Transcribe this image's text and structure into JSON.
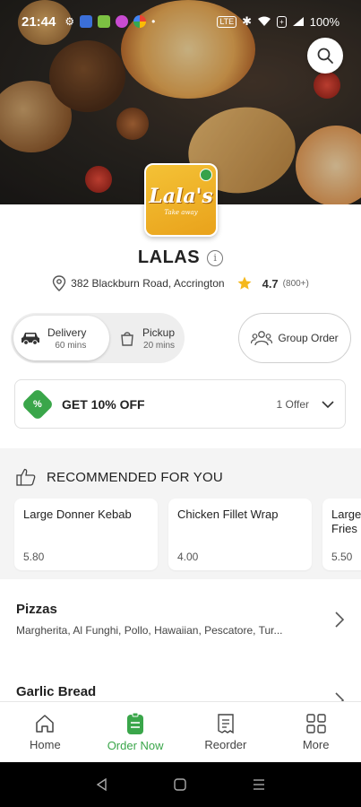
{
  "status_bar": {
    "time": "21:44",
    "battery": "100%",
    "lte_label": "LTE"
  },
  "store": {
    "name": "LALAS",
    "logo_text": "Lala's",
    "logo_subtext": "Take away",
    "address": "382 Blackburn Road, Accrington",
    "rating": "4.7",
    "rating_count": "(800+)"
  },
  "modes": {
    "delivery_label": "Delivery",
    "delivery_time": "60 mins",
    "pickup_label": "Pickup",
    "pickup_time": "20 mins",
    "group_order_label": "Group Order"
  },
  "offer": {
    "badge": "%",
    "title": "GET 10% OFF",
    "count": "1 Offer"
  },
  "recommended": {
    "title": "RECOMMENDED FOR YOU",
    "items": [
      {
        "name": "Large Donner Kebab",
        "price": "5.80"
      },
      {
        "name": "Chicken Fillet Wrap",
        "price": "4.00"
      },
      {
        "name": "Large Fries",
        "price": "5.50"
      }
    ]
  },
  "categories": [
    {
      "title": "Pizzas",
      "description": "Margherita, Al Funghi, Pollo, Hawaiian, Pescatore, Tur..."
    },
    {
      "title": "Garlic Bread",
      "description": ""
    }
  ],
  "bottom_nav": [
    {
      "label": "Home",
      "icon": "home-icon"
    },
    {
      "label": "Order Now",
      "icon": "order-icon"
    },
    {
      "label": "Reorder",
      "icon": "receipt-icon"
    },
    {
      "label": "More",
      "icon": "grid-icon"
    }
  ],
  "colors": {
    "accent_green": "#3aa64a",
    "logo_yellow": "#f4c236",
    "star_yellow": "#f5b81c"
  }
}
